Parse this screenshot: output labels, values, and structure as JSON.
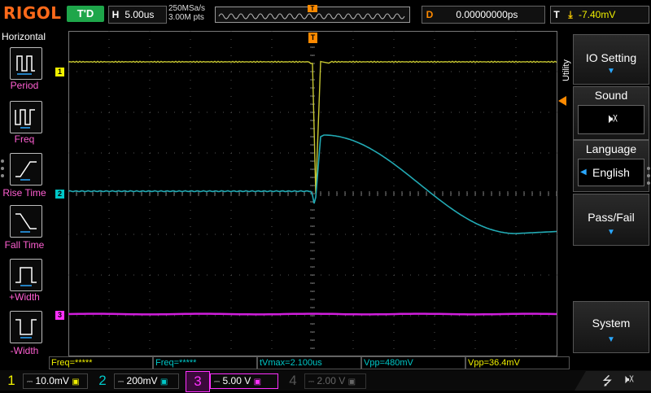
{
  "header": {
    "logo": "RIGOL",
    "run_status": "T'D",
    "timebase_label": "H",
    "timebase": "5.00us",
    "sample_rate": "250MSa/s",
    "memory_depth": "3.00M pts",
    "trigger_marker": "T",
    "delay_label": "D",
    "delay": "0.00000000ps",
    "trigger_label": "T",
    "trigger_level": "-7.40mV"
  },
  "horizontal_menu": {
    "title": "Horizontal",
    "items": [
      {
        "label": "Period"
      },
      {
        "label": "Freq"
      },
      {
        "label": "Rise Time"
      },
      {
        "label": "Fall Time"
      },
      {
        "label": "+Width"
      },
      {
        "label": "-Width"
      }
    ]
  },
  "grid": {
    "ch1_marker": "1",
    "ch2_marker": "2",
    "ch3_marker": "3",
    "trig_pos_marker": "T"
  },
  "right_menu": {
    "tab": "Utility",
    "io_setting": "IO Setting",
    "sound": "Sound",
    "language": "Language",
    "language_value": "English",
    "pass_fail": "Pass/Fail",
    "system": "System"
  },
  "measurements": [
    "Freq=*****",
    "Freq=*****",
    "tVmax=2.100us",
    "Vpp=480mV",
    "Vpp=36.4mV"
  ],
  "channels": [
    {
      "num": "1",
      "scale": "10.0mV",
      "color": "#f0f000"
    },
    {
      "num": "2",
      "scale": "200mV",
      "color": "#00c8c8"
    },
    {
      "num": "3",
      "scale": "5.00 V",
      "color": "#ff30ff"
    },
    {
      "num": "4",
      "scale": "2.00 V",
      "color": "#555555"
    }
  ],
  "colors": {
    "ch1": "#c8c832",
    "ch2": "#22aab4",
    "ch3": "#d01edc",
    "accent": "#ff8a00",
    "highlight": "#2aa8ff"
  },
  "icons": {
    "usb": "usb-icon",
    "sound": "speaker-muted-icon"
  }
}
